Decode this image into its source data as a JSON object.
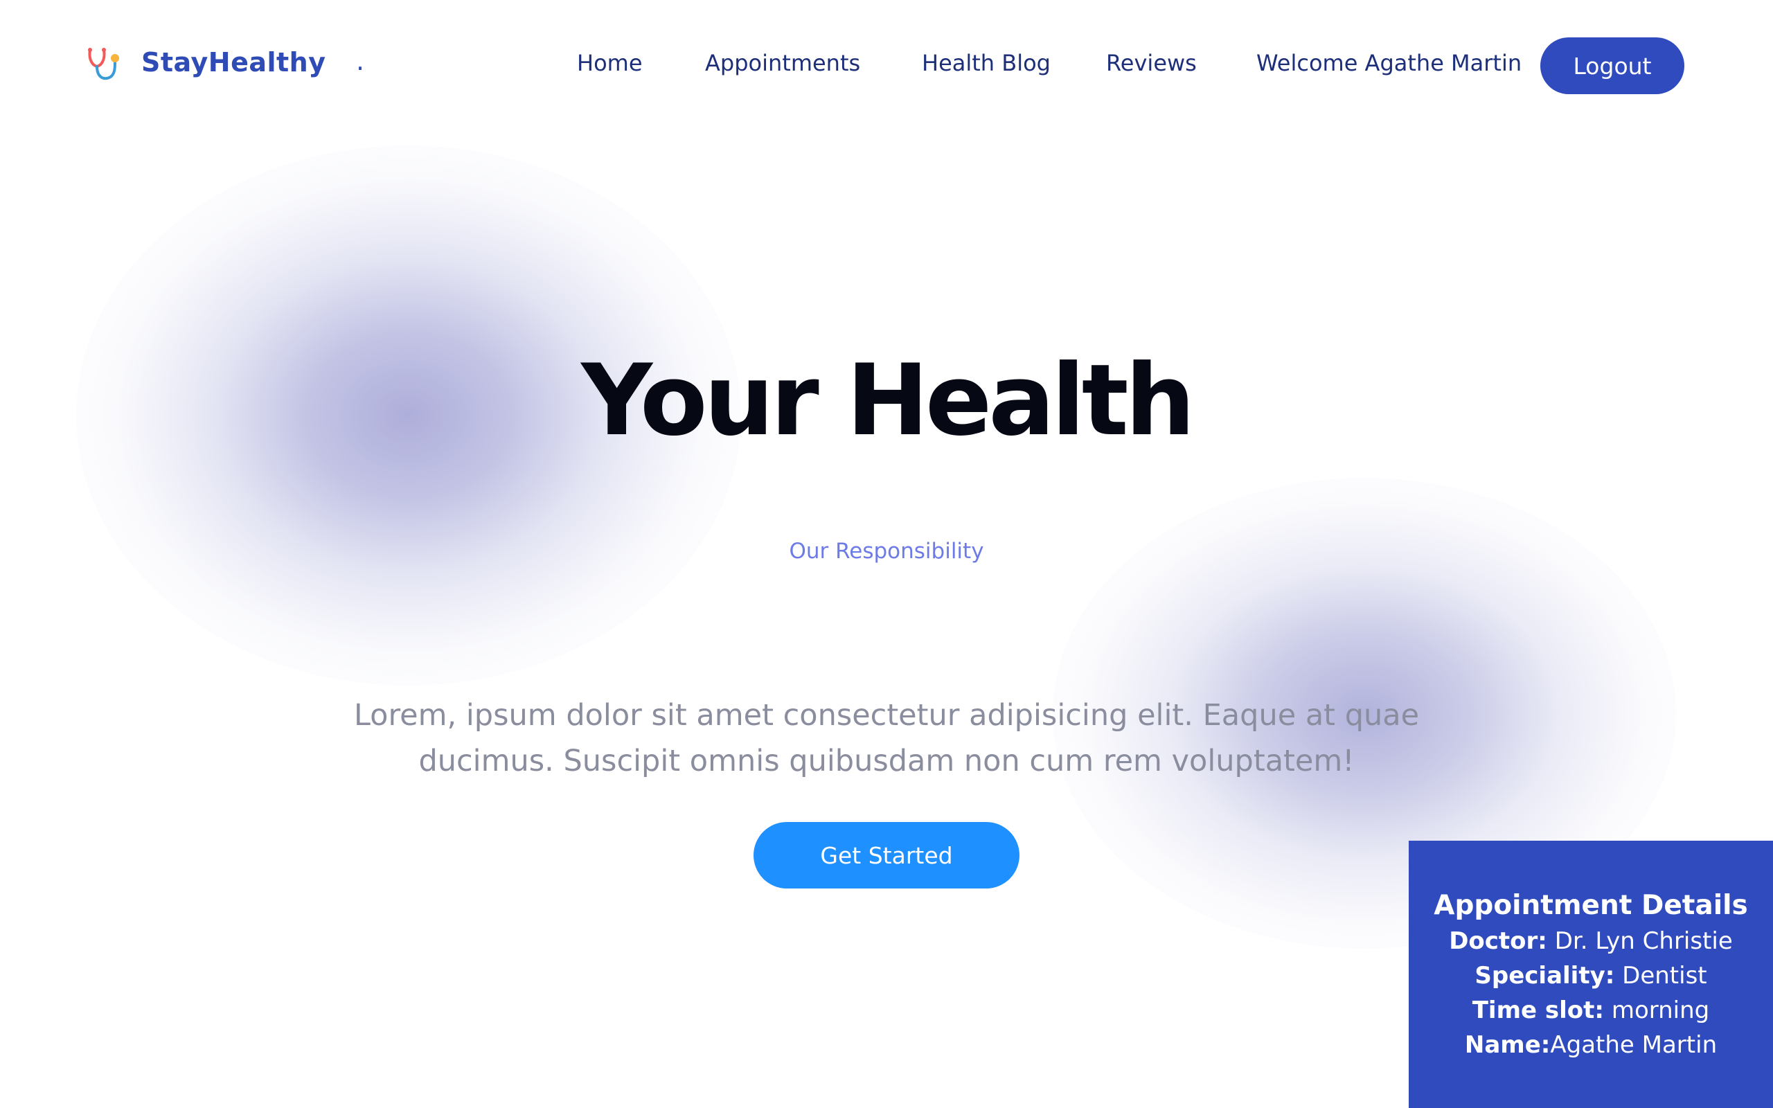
{
  "brand": {
    "name": "StayHealthy",
    "separator": "."
  },
  "nav": {
    "items": [
      {
        "label": "Home"
      },
      {
        "label": "Appointments"
      },
      {
        "label": "Health Blog"
      },
      {
        "label": "Reviews"
      },
      {
        "label": "Welcome Agathe Martin"
      }
    ],
    "logout_label": "Logout"
  },
  "hero": {
    "title": "Your Health",
    "subtitle": "Our Responsibility",
    "text": "Lorem, ipsum dolor sit amet consectetur adipisicing elit. Eaque at quae ducimus. Suscipit omnis quibusdam non cum rem voluptatem!",
    "cta_label": "Get Started"
  },
  "appointment": {
    "title": "Appointment Details",
    "doctor_label": "Doctor:",
    "doctor_value": " Dr. Lyn Christie",
    "speciality_label": "Speciality:",
    "speciality_value": " Dentist",
    "timeslot_label": "Time slot:",
    "timeslot_value": " morning",
    "name_label": "Name:",
    "name_value": "Agathe Martin"
  },
  "colors": {
    "brand": "#2f4bb5",
    "nav_text": "#1e2f7a",
    "cta": "#1e90ff",
    "panel": "#2f4bbd",
    "subtitle": "#6d7be6"
  },
  "icons": {
    "logo": "stethoscope-icon"
  }
}
